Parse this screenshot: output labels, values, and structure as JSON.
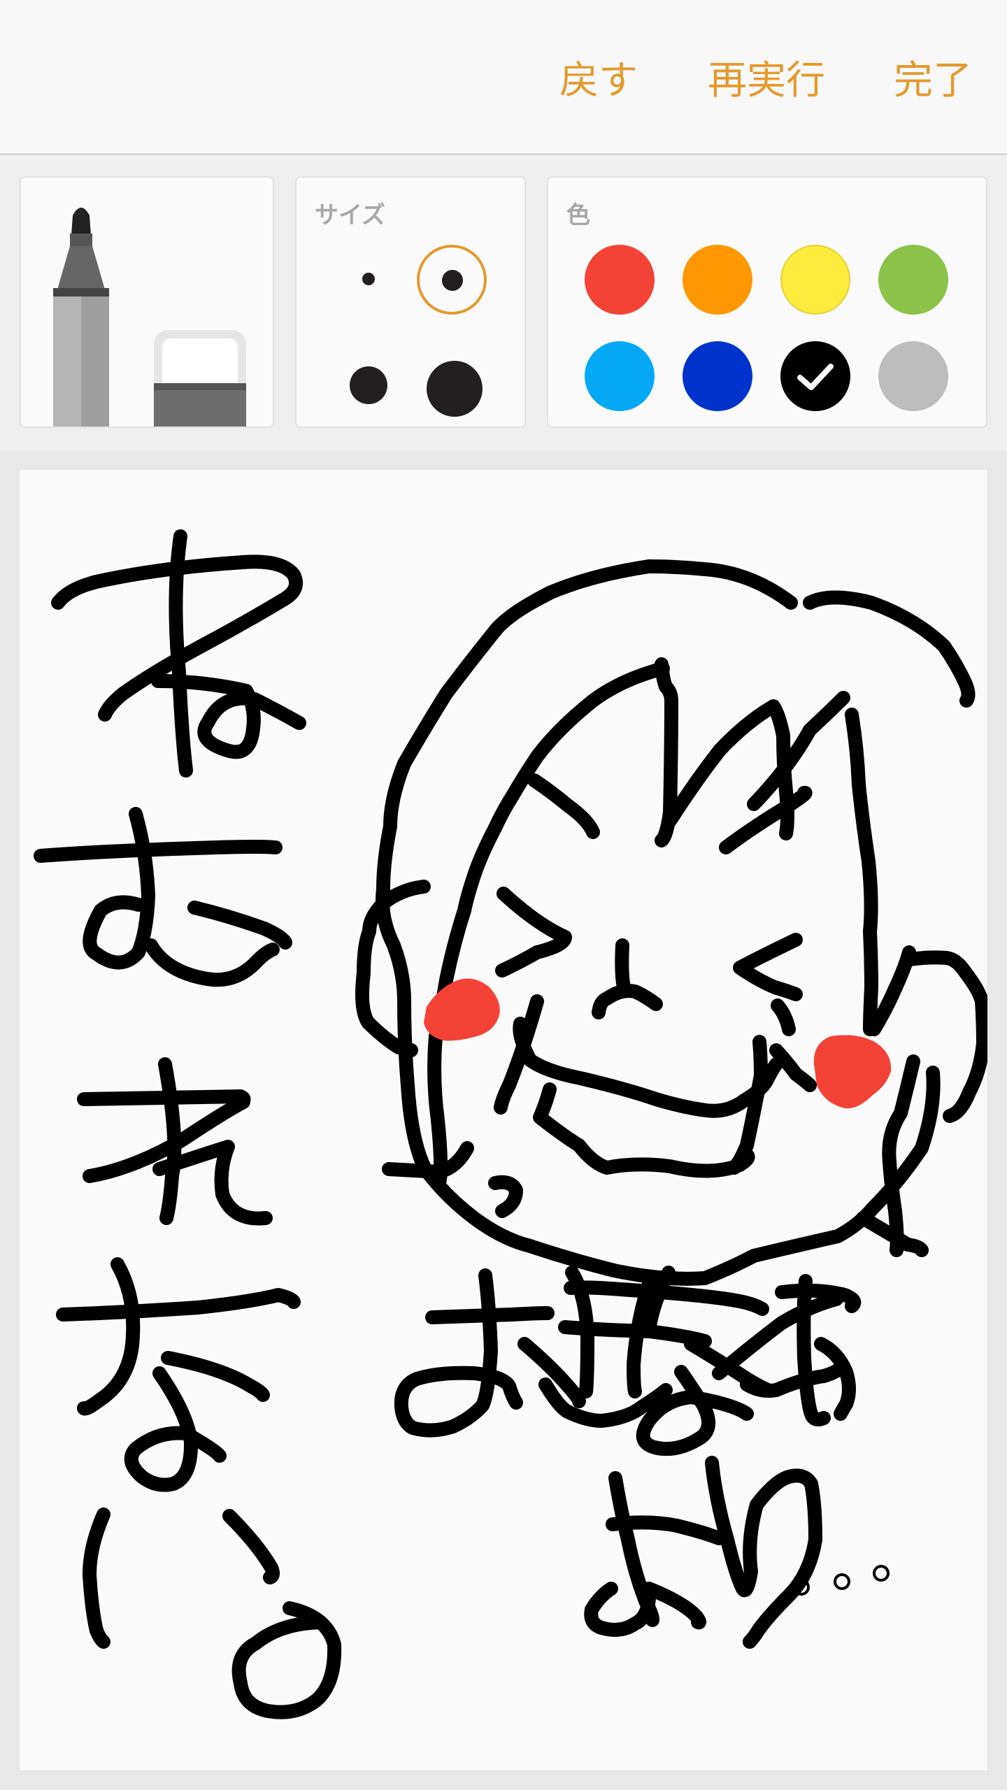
{
  "header": {
    "undo_label": "戻す",
    "redo_label": "再実行",
    "done_label": "完了"
  },
  "toolbar": {
    "tools": [
      {
        "name": "marker",
        "selected": true
      },
      {
        "name": "eraser",
        "selected": false
      }
    ]
  },
  "size_panel": {
    "label": "サイズ",
    "options": [
      "extra-small",
      "small",
      "medium",
      "large"
    ],
    "selected": "small"
  },
  "color_panel": {
    "label": "色",
    "colors": [
      "#f44336",
      "#ff9800",
      "#ffeb3b",
      "#8bc34a",
      "#03a9f4",
      "#0033cc",
      "#000000",
      "#bdbdbd"
    ],
    "selected": "#000000"
  },
  "canvas": {
    "ink_color": "#000000",
    "blush_color": "#f44336"
  }
}
